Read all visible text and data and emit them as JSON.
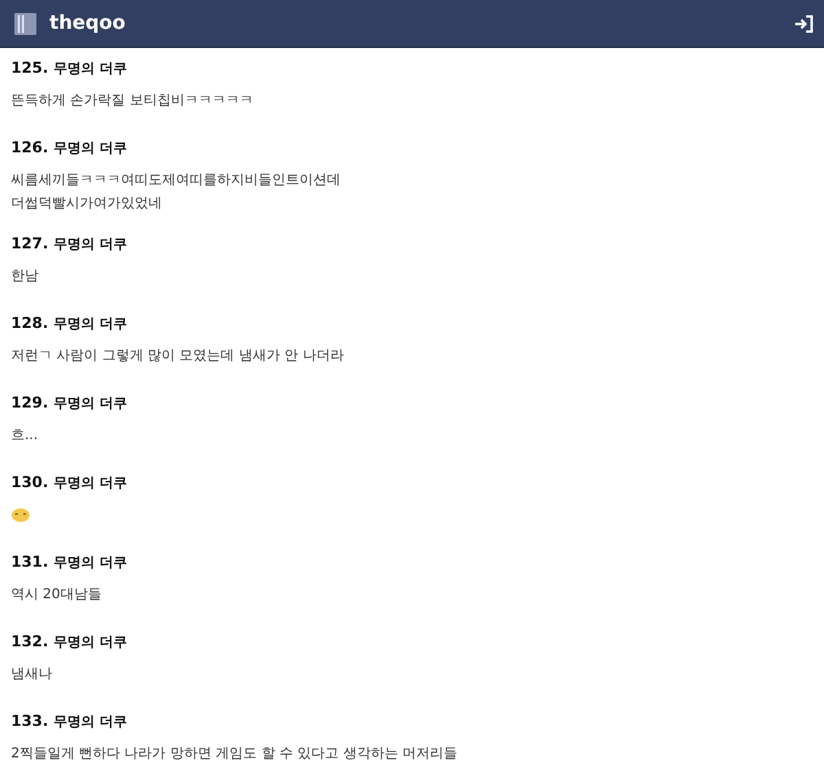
{
  "header": {
    "title": "theqoo"
  },
  "comments": [
    {
      "number": "125.",
      "author": "무명의 더쿠",
      "kind": "text",
      "lines": [
        "뜬득하게 손가락질 보티칩비ㅋㅋㅋㅋㅋ"
      ]
    },
    {
      "number": "126.",
      "author": "무명의 더쿠",
      "kind": "text",
      "lines": [
        "씨름세끼들ㅋㅋㅋ여띠도제여띠를하지비들인트이션데",
        "더썹덕빨시가여가있었네"
      ]
    },
    {
      "number": "127.",
      "author": "무명의 더쿠",
      "kind": "text",
      "lines": [
        "한남"
      ]
    },
    {
      "number": "128.",
      "author": "무명의 더쿠",
      "kind": "text",
      "lines": [
        "저런ㄱ 사람이 그렇게 많이 모였는데 냄새가 안 나더라"
      ]
    },
    {
      "number": "129.",
      "author": "무명의 더쿠",
      "kind": "text",
      "lines": [
        "흐..."
      ]
    },
    {
      "number": "130.",
      "author": "무명의 더쿠",
      "kind": "emoticon"
    },
    {
      "number": "131.",
      "author": "무명의 더쿠",
      "kind": "text",
      "lines": [
        "역시 20대남들"
      ]
    },
    {
      "number": "132.",
      "author": "무명의 더쿠",
      "kind": "text",
      "lines": [
        "냄새나"
      ]
    },
    {
      "number": "133.",
      "author": "무명의 더쿠",
      "kind": "text",
      "lines": [
        "2찍들일게 뻔하다 나라가 망하면 게임도 할 수 있다고 생각하는 머저리들"
      ]
    }
  ]
}
